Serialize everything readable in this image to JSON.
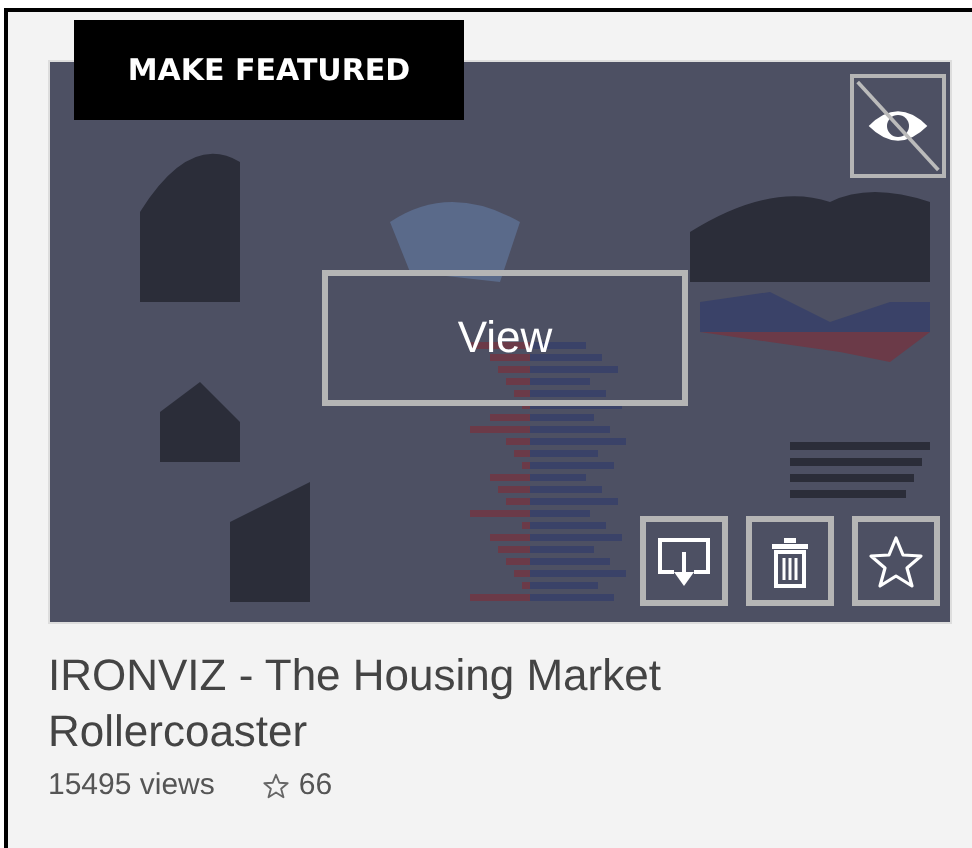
{
  "card": {
    "feature_button": "MAKE FEATURED",
    "view_button": "View",
    "title": "IRONVIZ - The Housing Market Rollercoaster",
    "views": "15495 views",
    "favorites": "66"
  }
}
